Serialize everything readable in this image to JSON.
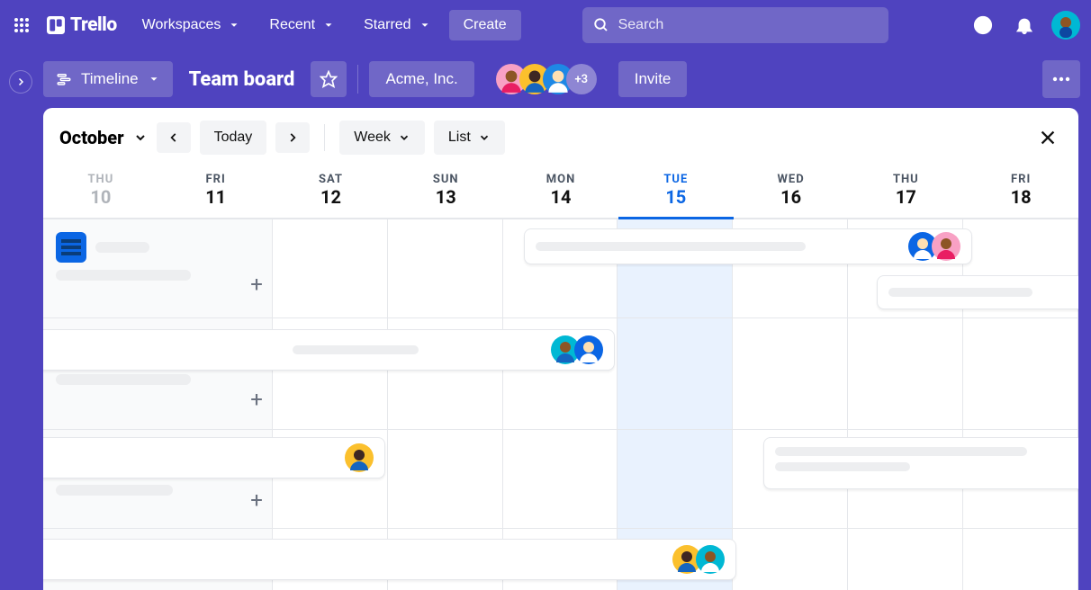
{
  "brand": {
    "name": "Trello"
  },
  "nav": {
    "workspaces": "Workspaces",
    "recent": "Recent",
    "starred": "Starred",
    "create": "Create"
  },
  "search": {
    "placeholder": "Search"
  },
  "board": {
    "view": "Timeline",
    "title": "Team board",
    "org": "Acme, Inc.",
    "more_count": "+3",
    "invite": "Invite"
  },
  "toolbar": {
    "month": "October",
    "today": "Today",
    "week": "Week",
    "list": "List"
  },
  "days": [
    {
      "name": "THU",
      "num": "10",
      "state": "past"
    },
    {
      "name": "FRI",
      "num": "11",
      "state": ""
    },
    {
      "name": "SAT",
      "num": "12",
      "state": ""
    },
    {
      "name": "SUN",
      "num": "13",
      "state": ""
    },
    {
      "name": "MON",
      "num": "14",
      "state": ""
    },
    {
      "name": "TUE",
      "num": "15",
      "state": "today"
    },
    {
      "name": "WED",
      "num": "16",
      "state": ""
    },
    {
      "name": "THU",
      "num": "17",
      "state": ""
    },
    {
      "name": "FRI",
      "num": "18",
      "state": ""
    }
  ],
  "colors": {
    "brand": "#4F43BF",
    "accent": "#0B66E4"
  }
}
